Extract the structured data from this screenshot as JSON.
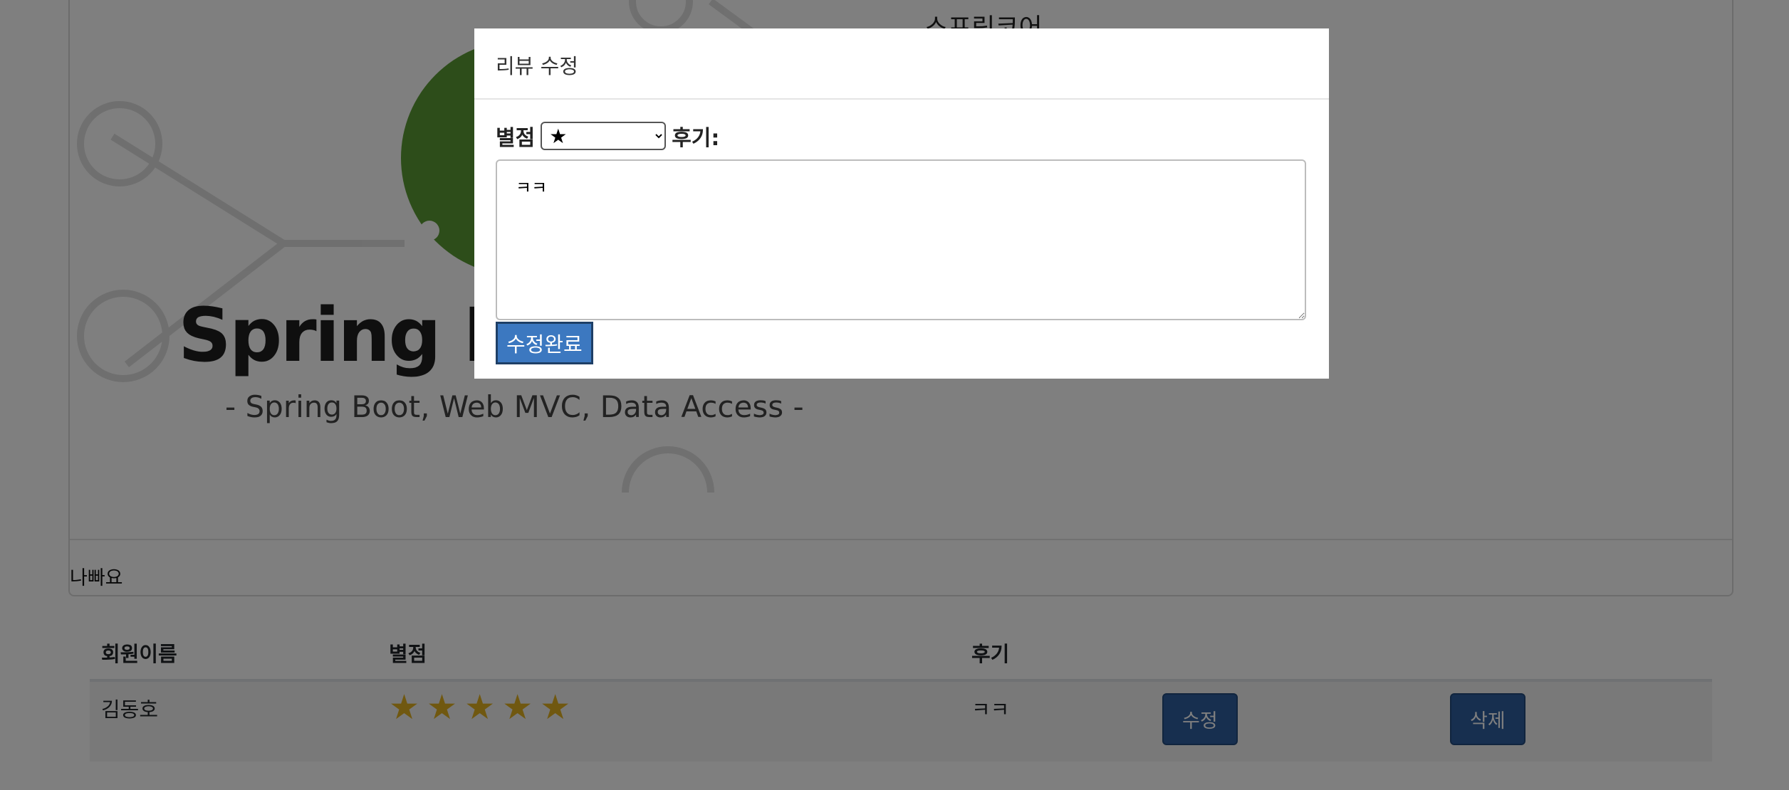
{
  "background": {
    "card_top_title": "스프링코어",
    "banner": {
      "title": "Spring Int",
      "subtitle": "- Spring Boot, Web MVC, Data Access -"
    },
    "card_footer_text": "나빠요",
    "table": {
      "headers": [
        "회원이름",
        "별점",
        "후기",
        "",
        ""
      ],
      "rows": [
        {
          "member": "김동호",
          "rating": 5,
          "stars": "★★★★★",
          "review": "ㅋㅋ",
          "edit_label": "수정",
          "delete_label": "삭제"
        }
      ]
    }
  },
  "modal": {
    "title": "리뷰 수정",
    "rating_label": "별점",
    "rating_selected": "★",
    "review_label": "후기:",
    "review_text": "ㅋㅋ",
    "submit_label": "수정완료"
  },
  "colors": {
    "star": "#e0b020",
    "primary_button": "#2f5f9e",
    "submit_button": "#3c78c0",
    "spring_green": "#5b9a34"
  }
}
